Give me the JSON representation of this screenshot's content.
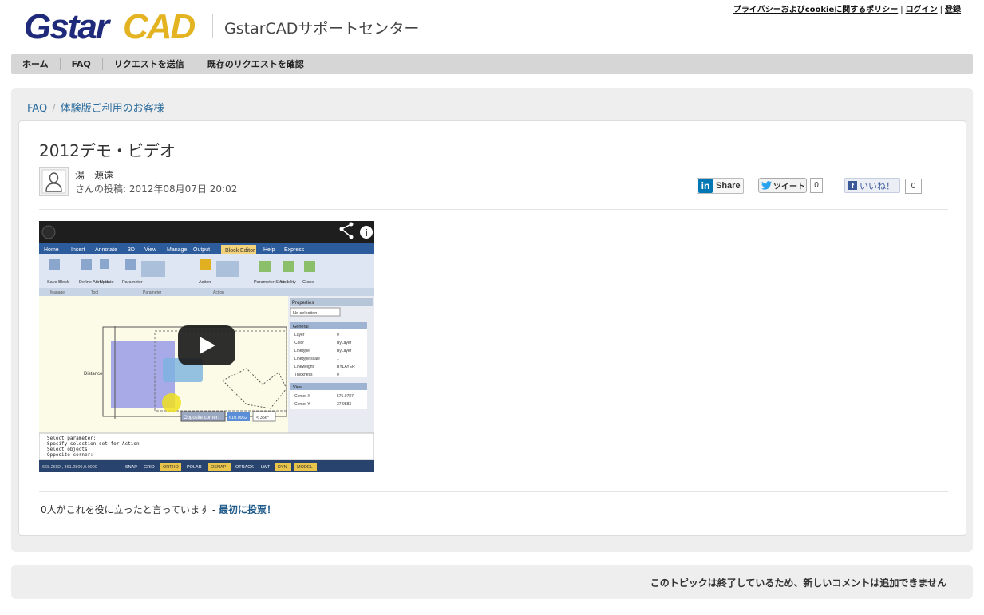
{
  "header": {
    "logo_text": "GstarCAD",
    "site_title": "GstarCADサポートセンター",
    "top_links": [
      "プライバシーおよびcookieに関するポリシー",
      "ログイン",
      "登録"
    ],
    "top_link_separator": "|"
  },
  "nav": {
    "items": [
      "ホーム",
      "FAQ",
      "リクエストを送信",
      "既存のリクエストを確認"
    ]
  },
  "breadcrumb": {
    "items": [
      "FAQ",
      "体験版ご利用のお客様"
    ],
    "separator": "/"
  },
  "article": {
    "title": "2012デモ・ビデオ",
    "author": "湯　源遠",
    "posted": "さんの投稿: 2012年08月07日 20:02",
    "avatar_icon": "user-silhouette-icon"
  },
  "share": {
    "linkedin_label": "Share",
    "twitter_label": "ツイート",
    "twitter_count": "0",
    "facebook_label": "いいね！",
    "facebook_count": "0"
  },
  "video": {
    "menu_tabs": [
      "Home",
      "Insert",
      "Annotate",
      "3D",
      "View",
      "Manage",
      "Output",
      "Block Editor",
      "Help",
      "Express"
    ],
    "ribbon_groups": [
      "Manage",
      "Tool",
      "Parameter",
      "Action"
    ],
    "ribbon_buttons": [
      "Save Block",
      "Define Attribute",
      "Update",
      "Parameter",
      "Action",
      "Parameter Sets",
      "Visibility",
      "Clone"
    ],
    "properties_title": "Properties",
    "properties_selector": "No selection",
    "prop_section_general": "General",
    "prop_rows": [
      {
        "name": "Layer",
        "value": "0"
      },
      {
        "name": "Color",
        "value": "ByLayer"
      },
      {
        "name": "Linetype",
        "value": "ByLayer"
      },
      {
        "name": "Linetype scale",
        "value": "1"
      },
      {
        "name": "Lineweight",
        "value": "BYLAYER"
      },
      {
        "name": "Thickness",
        "value": "0"
      }
    ],
    "prop_section_view": "View",
    "prop_view_rows": [
      {
        "name": "Center X",
        "value": "575.0787"
      },
      {
        "name": "Center Y",
        "value": "37.9883"
      }
    ],
    "drawing_label": "Distance",
    "drawing_tag": "Opposite corner:",
    "drawing_value": "610.0962",
    "drawing_angle": "< 356°",
    "command_lines": [
      "Select parameter:",
      "Specify selection set for Action",
      "Select objects:",
      "Opposite corner:"
    ],
    "coords": "668.2682 , 361.2800,0.0000",
    "status_buttons": [
      "SNAP",
      "GRID",
      "ORTHO",
      "POLAR",
      "OSNAP",
      "OTRACK",
      "LWT",
      "DYN",
      "MODEL"
    ],
    "share_icon": "share-icon",
    "info_icon": "info-icon",
    "play_icon": "play-icon"
  },
  "vote": {
    "text": "0人がこれを役に立ったと言っています - ",
    "link": "最初に投票！"
  },
  "footer": {
    "closed_message": "このトピックは終了しているため、新しいコメントは追加できません"
  },
  "colors": {
    "link": "#2c6c9c",
    "nav_bg": "#d6d6d6",
    "panel_bg": "#eeeeee",
    "logo_blue": "#1f2a7a",
    "logo_gold": "#e3b321",
    "linkedin": "#0077b5",
    "facebook": "#3b5998"
  }
}
